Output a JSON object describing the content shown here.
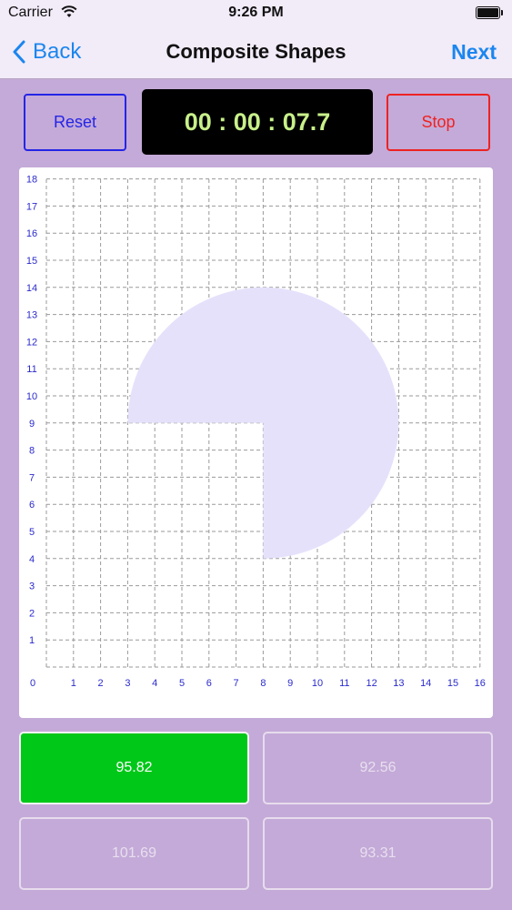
{
  "status_bar": {
    "carrier": "Carrier",
    "time": "9:26 PM",
    "wifi_icon": "wifi-icon",
    "battery_icon": "battery-icon"
  },
  "nav": {
    "back_label": "Back",
    "back_icon": "chevron-left-icon",
    "title": "Composite Shapes",
    "next_label": "Next"
  },
  "controls": {
    "reset_label": "Reset",
    "timer": "00 : 00 : 07.7",
    "stop_label": "Stop"
  },
  "grid": {
    "x_ticks": [
      "0",
      "1",
      "2",
      "3",
      "4",
      "5",
      "6",
      "7",
      "8",
      "9",
      "10",
      "11",
      "12",
      "13",
      "14",
      "15",
      "16"
    ],
    "y_ticks": [
      "1",
      "2",
      "3",
      "4",
      "5",
      "6",
      "7",
      "8",
      "9",
      "10",
      "11",
      "12",
      "13",
      "14",
      "15",
      "16",
      "17",
      "18"
    ],
    "x_range": [
      0,
      16
    ],
    "y_range": [
      0,
      18
    ],
    "shape": {
      "description_type": "three-quarter circle",
      "center": [
        8,
        9
      ],
      "radius": 5,
      "missing_quadrant": "bottom-left"
    }
  },
  "answers": [
    {
      "label": "95.82",
      "selected": true
    },
    {
      "label": "92.56",
      "selected": false
    },
    {
      "label": "101.69",
      "selected": false
    },
    {
      "label": "93.31",
      "selected": false
    }
  ],
  "colors": {
    "background": "#c4aad8",
    "shape_fill": "#e6e1fb",
    "tick_label": "#2a2acc",
    "selected_answer": "#00c819",
    "ios_blue": "#1b86ef",
    "timer_text": "#c8f08a",
    "reset_border": "#2525e6",
    "stop_border": "#ee2222"
  }
}
